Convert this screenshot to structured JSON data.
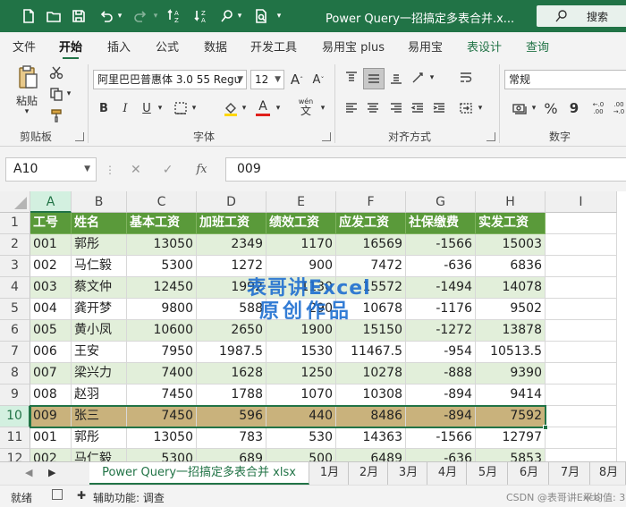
{
  "titlebar": {
    "doc_title": "Power Query一招搞定多表合并.x...",
    "search_label": "搜索"
  },
  "ribbon_tabs": [
    "文件",
    "开始",
    "插入",
    "公式",
    "数据",
    "开发工具",
    "易用宝 plus",
    "易用宝",
    "表设计",
    "查询"
  ],
  "active_tab": "开始",
  "ribbon": {
    "paste_label": "粘贴",
    "clipboard_label": "剪贴板",
    "font_name": "阿里巴巴普惠体 3.0 55 Regu",
    "font_size": "12",
    "font_group_label": "字体",
    "bold": "B",
    "italic": "I",
    "underline": "U",
    "wen": "wén",
    "wen_char": "文",
    "align_group_label": "对齐方式",
    "number_format": "常规",
    "number_group_label": "数字",
    "percent": "%",
    "comma": "9"
  },
  "formula_bar": {
    "name_box": "A10",
    "formula": "009",
    "fx": "fx"
  },
  "columns": [
    "A",
    "B",
    "C",
    "D",
    "E",
    "F",
    "G",
    "H",
    "I"
  ],
  "selected_column": "A",
  "row_numbers": [
    "1",
    "2",
    "3",
    "4",
    "5",
    "6",
    "7",
    "8",
    "9",
    "10",
    "11",
    "12"
  ],
  "selected_row": "10",
  "table": {
    "headers": [
      "工号",
      "姓名",
      "基本工资",
      "加班工资",
      "绩效工资",
      "应发工资",
      "社保缴费",
      "实发工资"
    ],
    "rows": [
      [
        "001",
        "郭彤",
        "13050",
        "2349",
        "1170",
        "16569",
        "-1566",
        "15003"
      ],
      [
        "002",
        "马仁毅",
        "5300",
        "1272",
        "900",
        "7472",
        "-636",
        "6836"
      ],
      [
        "003",
        "蔡文仲",
        "12450",
        "1992",
        "1130",
        "15572",
        "-1494",
        "14078"
      ],
      [
        "004",
        "龚开梦",
        "9800",
        "588",
        "290",
        "10678",
        "-1176",
        "9502"
      ],
      [
        "005",
        "黄小凤",
        "10600",
        "2650",
        "1900",
        "15150",
        "-1272",
        "13878"
      ],
      [
        "006",
        "王安",
        "7950",
        "1987.5",
        "1530",
        "11467.5",
        "-954",
        "10513.5"
      ],
      [
        "007",
        "梁兴力",
        "7400",
        "1628",
        "1250",
        "10278",
        "-888",
        "9390"
      ],
      [
        "008",
        "赵羽",
        "7450",
        "1788",
        "1070",
        "10308",
        "-894",
        "9414"
      ],
      [
        "009",
        "张三",
        "7450",
        "596",
        "440",
        "8486",
        "-894",
        "7592"
      ],
      [
        "001",
        "郭彤",
        "13050",
        "783",
        "530",
        "14363",
        "-1566",
        "12797"
      ],
      [
        "002",
        "马仁毅",
        "5300",
        "689",
        "500",
        "6489",
        "-636",
        "5853"
      ]
    ]
  },
  "watermark": [
    "表哥讲Excel",
    "原创作品"
  ],
  "sheet_tabs": [
    "Power Query一招搞定多表合并 xlsx",
    "1月",
    "2月",
    "3月",
    "4月",
    "5月",
    "6月",
    "7月",
    "8月"
  ],
  "active_sheet": "Power Query一招搞定多表合并 xlsx",
  "status": {
    "ready": "就绪",
    "accessibility": "辅助功能: 调查",
    "right_text": "CSDN @表哥讲Excel",
    "avg": "平均值: 3"
  },
  "colors": {
    "excel_green": "#217346",
    "header_fill": "#5a9a3a",
    "band_fill": "#e2efda",
    "highlight_fill": "#c9b27c",
    "watermark": "#1f6fd1"
  }
}
